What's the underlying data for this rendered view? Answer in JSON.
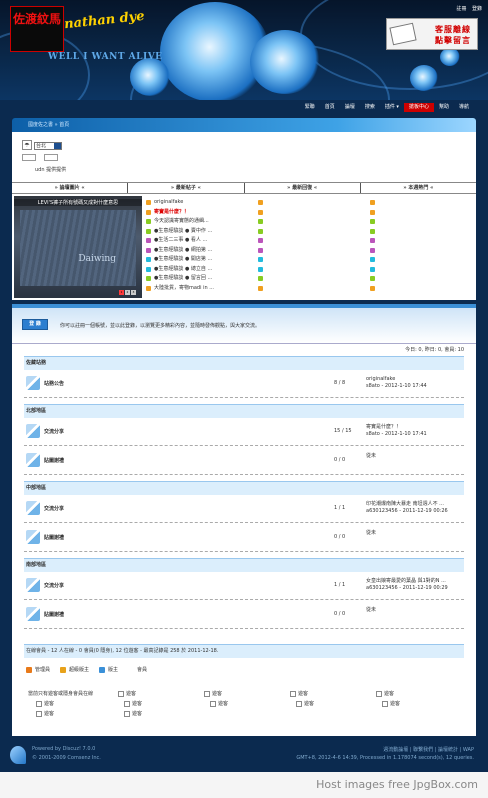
{
  "header": {
    "logo_cn": "佐渡紋馬",
    "logo_en": "nathan dye",
    "slogan": "WELL I WANT ALIVE",
    "toplinks": [
      "註冊",
      "登錄"
    ],
    "service_box": [
      "客服離線",
      "點擊留言"
    ]
  },
  "nav": [
    "緊聯",
    "首頁",
    "論壇",
    "搜索",
    "插件 ▾",
    "搶板中心",
    "幫助",
    "導航"
  ],
  "breadcrumb": "國度佐之書 » 首頁",
  "widget": {
    "select_value": "台北",
    "provider": "udn 提供提供"
  },
  "columns": [
    "» 論壇圖片 «",
    "» 最新帖子 «",
    "» 最新回復 «",
    "» 本週熱門 «"
  ],
  "photo": {
    "caption": "LEVI'S褲子所有號碼又成對什麼意思",
    "brand": "Daiwing",
    "pages": [
      "1",
      "2",
      "3"
    ]
  },
  "new_posts": [
    {
      "text": "originalfake",
      "color": "#f0a020",
      "red": false
    },
    {
      "text": "寄實是什麼？！",
      "color": "#f0a020",
      "red": true
    },
    {
      "text": "今天認識寄實態的通緝...",
      "color": "#8c2",
      "red": false
    },
    {
      "text": "●生意經驗談 ● 賣中作 ...",
      "color": "#8c2",
      "red": false
    },
    {
      "text": "●生活二三事 ● 看人 ...",
      "color": "#b5b",
      "red": false
    },
    {
      "text": "●生意經驗談 ● 網拍第 ...",
      "color": "#b5b",
      "red": false
    },
    {
      "text": "●生意經驗談 ● 開店第 ...",
      "color": "#2bd",
      "red": false
    },
    {
      "text": "●生意經驗談 ● 總立自 ...",
      "color": "#2bd",
      "red": false
    },
    {
      "text": "●生意經驗談 ● 留言回 ...",
      "color": "#8c2",
      "red": false
    },
    {
      "text": "大陸批貨，寄物madi in ...",
      "color": "#f0a020",
      "red": false
    }
  ],
  "reply_colors": [
    "#f0a020",
    "#f0a020",
    "#8c2",
    "#8c2",
    "#b5b",
    "#b5b",
    "#2bd",
    "#2bd",
    "#8c2",
    "#f0a020"
  ],
  "hot_colors": [
    "#f0a020",
    "#f0a020",
    "#8c2",
    "#8c2",
    "#b5b",
    "#b5b",
    "#2bd",
    "#2bd",
    "#8c2",
    "#f0a020"
  ],
  "welcome": {
    "button": "登  錄",
    "text": "你可以註冊一個帳號，並以此登錄，以瀏覽更多精彩內容，並隨時發佈觀點，與大家交流。"
  },
  "stats": "今日: 0, 昨日: 0, 會員: 10",
  "sections": [
    {
      "name": "佐藏站務",
      "forums": [
        {
          "name": "站務公告",
          "count": "8 / 8",
          "last_title": "originalfake",
          "last_meta": "s8ato - 2012-1-10 17:44"
        }
      ]
    },
    {
      "name": "北部地區",
      "forums": [
        {
          "name": "交流分享",
          "count": "15 / 15",
          "last_title": "寄實是什麼？！",
          "last_meta": "s8ato - 2012-1-10 17:41"
        },
        {
          "name": "貼圖謝禮",
          "count": "0 / 0",
          "last_title": "從未",
          "last_meta": ""
        }
      ]
    },
    {
      "name": "中部地區",
      "forums": [
        {
          "name": "交流分享",
          "count": "1 / 1",
          "last_title": "印花潮爆南陳大暴走 南坦週人不 ...",
          "last_meta": "a630123456 - 2011-12-19 00:26"
        },
        {
          "name": "貼圖謝禮",
          "count": "0 / 0",
          "last_title": "從未",
          "last_meta": ""
        }
      ]
    },
    {
      "name": "南部地區",
      "forums": [
        {
          "name": "交流分享",
          "count": "1 / 1",
          "last_title": "女皇出娘寄最愛的葉晶 與1對的N ...",
          "last_meta": "a630123456 - 2011-12-19 00:29"
        },
        {
          "name": "貼圖謝禮",
          "count": "0 / 0",
          "last_title": "從未",
          "last_meta": ""
        }
      ]
    }
  ],
  "online": "在線會員 - 12 人在線 - 0 會員(0 隱身), 12 位遊客 - 最高記錄是 258 於 2011-12-18.",
  "legend": [
    {
      "label": "管理員",
      "color": "#e87a1a"
    },
    {
      "label": "超級版主",
      "color": "#e8a21a"
    },
    {
      "label": "版主",
      "color": "#3a90d8"
    },
    {
      "label": "會員",
      "color": "#ffffff"
    }
  ],
  "guests_note": "當前只有遊客或隱身會員在線",
  "guest_label": "遊客",
  "footer": {
    "powered": "Powered by Discuz! 7.0.0",
    "copyright": "© 2001-2009 Comsenz Inc.",
    "links": "週流動論壇 | 聯繫我們 | 論壇統計 | WAP",
    "time": "GMT+8, 2012-4-6 14:39, Processed in 1.178074 second(s), 12 queries."
  },
  "watermark": "Host images free JpgBox.com"
}
